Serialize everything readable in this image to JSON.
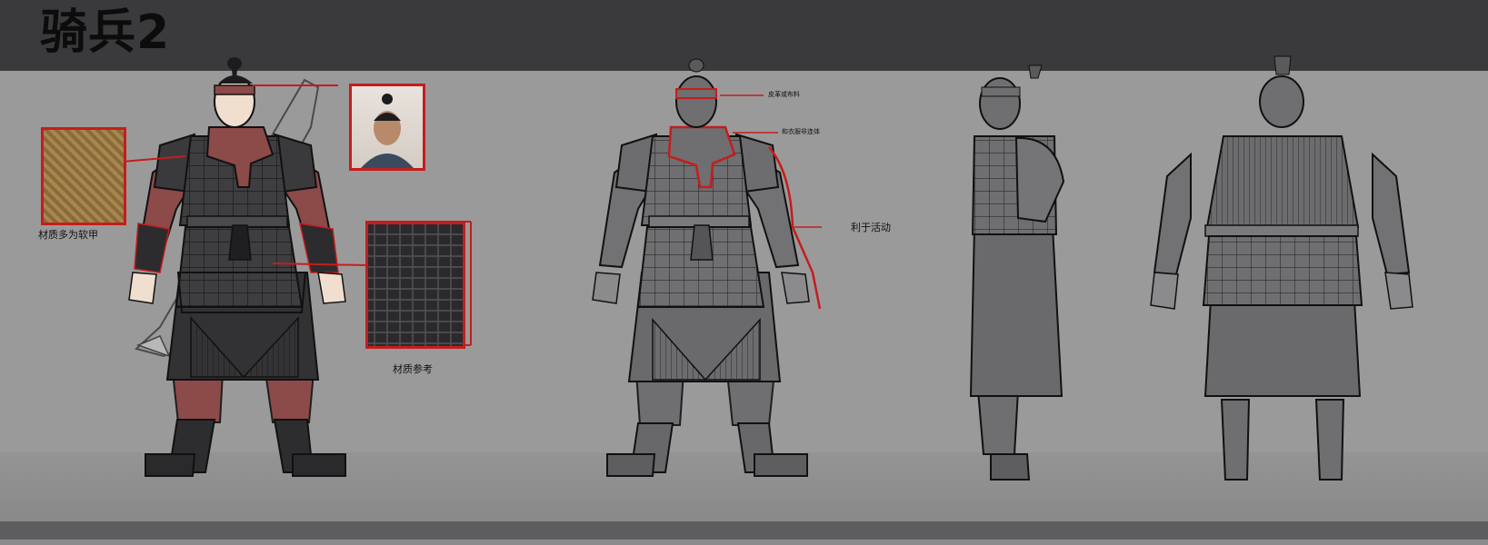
{
  "title": "骑兵2",
  "annotations": {
    "soft_armor": "材质多为软甲",
    "material_reference": "材质参考",
    "leather_or_cloth": "皮革或布料",
    "clothing_not_connected": "和衣服非连体",
    "ease_of_movement": "利于活动"
  },
  "colors": {
    "header": "#3a393b",
    "background": "#9b9a9b",
    "annotation_red": "#c41d1d",
    "armor_dark": "#3b3a3c",
    "cloth_red": "#8c4a48"
  }
}
